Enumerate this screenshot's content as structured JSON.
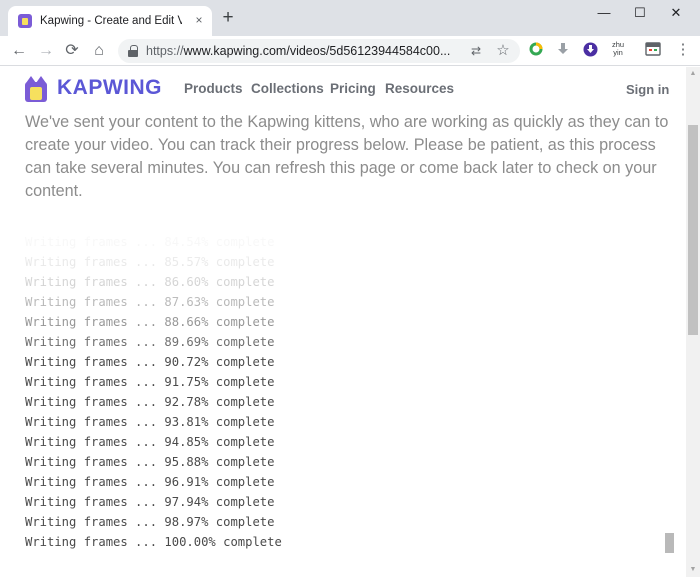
{
  "browser": {
    "tab_title": "Kapwing - Create and Edit Vide",
    "tab_close_icon": "×",
    "new_tab_icon": "+",
    "url_scheme": "https://",
    "url_rest": "www.kapwing.com/videos/5d56123944584c00...",
    "controls": {
      "minimize": "—",
      "maximize": "☐",
      "close": "✕"
    },
    "nav": {
      "back": "←",
      "forward": "→",
      "reload": "⟳",
      "home": "⌂"
    },
    "omni_icons": {
      "translate": "⇄",
      "star": "☆"
    },
    "extensions": {
      "zhuyin": "zhu yin",
      "menu": "⋮"
    }
  },
  "site": {
    "logo_text": "KAPWING",
    "nav": [
      "Products",
      "Collections",
      "Pricing",
      "Resources"
    ],
    "signin": "Sign in"
  },
  "intro": "We've sent your content to the Kapwing kittens, who are working as quickly as they can to create your video. You can track their progress below. Please be patient, as this process can take several minutes. You can refresh this page or come back later to check on your content.",
  "log_lines": [
    "Writing frames ... 84.54% complete",
    "Writing frames ... 85.57% complete",
    "Writing frames ... 86.60% complete",
    "Writing frames ... 87.63% complete",
    "Writing frames ... 88.66% complete",
    "Writing frames ... 89.69% complete",
    "Writing frames ... 90.72% complete",
    "Writing frames ... 91.75% complete",
    "Writing frames ... 92.78% complete",
    "Writing frames ... 93.81% complete",
    "Writing frames ... 94.85% complete",
    "Writing frames ... 95.88% complete",
    "Writing frames ... 96.91% complete",
    "Writing frames ... 97.94% complete",
    "Writing frames ... 98.97% complete",
    "Writing frames ... 100.00% complete"
  ],
  "colors": {
    "brand": "#5b57d6",
    "logo_purple": "#7b5cd6",
    "logo_yellow": "#f6e05e",
    "log_text": "#4a4a4a"
  },
  "scrollbar": {
    "up": "▲",
    "down": "▼"
  }
}
